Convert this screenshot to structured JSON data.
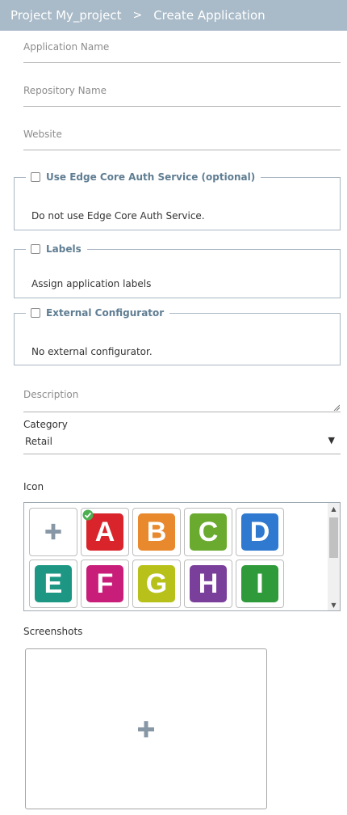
{
  "header": {
    "project": "Project My_project",
    "separator": ">",
    "page": "Create Application"
  },
  "fields": {
    "application_name": "Application Name",
    "repository_name": "Repository Name",
    "website": "Website"
  },
  "auth_service": {
    "legend": "Use Edge Core Auth Service (optional)",
    "text": "Do not use Edge Core Auth Service."
  },
  "labels": {
    "legend": "Labels",
    "text": "Assign application labels"
  },
  "external_configurator": {
    "legend": "External Configurator",
    "text": "No external configurator."
  },
  "description": {
    "placeholder": "Description"
  },
  "category": {
    "label": "Category",
    "value": "Retail"
  },
  "icon": {
    "label": "Icon",
    "tiles": [
      {
        "letter": "A",
        "color": "#d9242b",
        "selected": true
      },
      {
        "letter": "B",
        "color": "#e8892d"
      },
      {
        "letter": "C",
        "color": "#6aaa2f"
      },
      {
        "letter": "D",
        "color": "#2f7ad0"
      },
      {
        "letter": "E",
        "color": "#1d9784"
      },
      {
        "letter": "F",
        "color": "#c81e79"
      },
      {
        "letter": "G",
        "color": "#b7c11a"
      },
      {
        "letter": "H",
        "color": "#7a3f9b"
      },
      {
        "letter": "I",
        "color": "#2f9a3a"
      }
    ]
  },
  "screenshots": {
    "label": "Screenshots"
  },
  "colors": {
    "header": "#a9bac8",
    "legend": "#5f7d92",
    "plus": "#8897a5",
    "check": "#4caf50"
  }
}
